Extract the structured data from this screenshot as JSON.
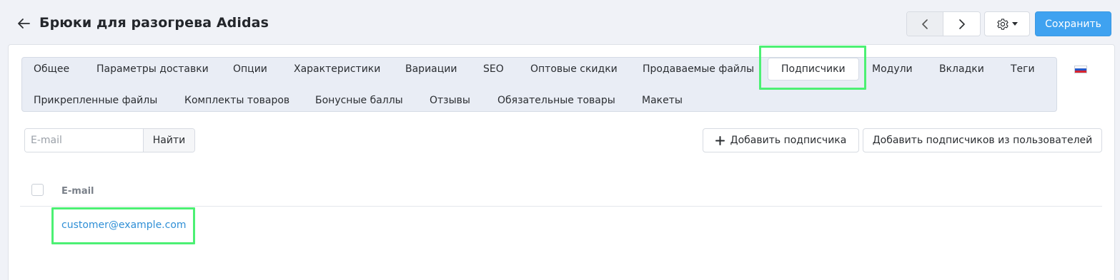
{
  "header": {
    "title": "Брюки для разогрева Adidas",
    "save_label": "Сохранить"
  },
  "tabs": {
    "row1": [
      "Общее",
      "Параметры доставки",
      "Опции",
      "Характеристики",
      "Вариации",
      "SEO",
      "Оптовые скидки",
      "Продаваемые файлы",
      "Подписчики",
      "Модули",
      "Вкладки",
      "Теги"
    ],
    "row2": [
      "Прикрепленные файлы",
      "Комплекты товаров",
      "Бонусные баллы",
      "Отзывы",
      "Обязательные товары",
      "Макеты"
    ],
    "active": "Подписчики",
    "language_flag_colors": [
      "#ffffff",
      "#2557c8",
      "#d8242f"
    ]
  },
  "toolbar": {
    "search_placeholder": "E-mail",
    "search_value": "",
    "search_button": "Найти",
    "add_subscriber": "Добавить подписчика",
    "add_from_users": "Добавить подписчиков из пользователей"
  },
  "table": {
    "columns": [
      "E-mail"
    ],
    "rows": [
      {
        "email": "customer@example.com"
      }
    ]
  },
  "colors": {
    "accent": "#3fa2f0",
    "link": "#2f8fd6",
    "highlight": "#4cf073"
  }
}
